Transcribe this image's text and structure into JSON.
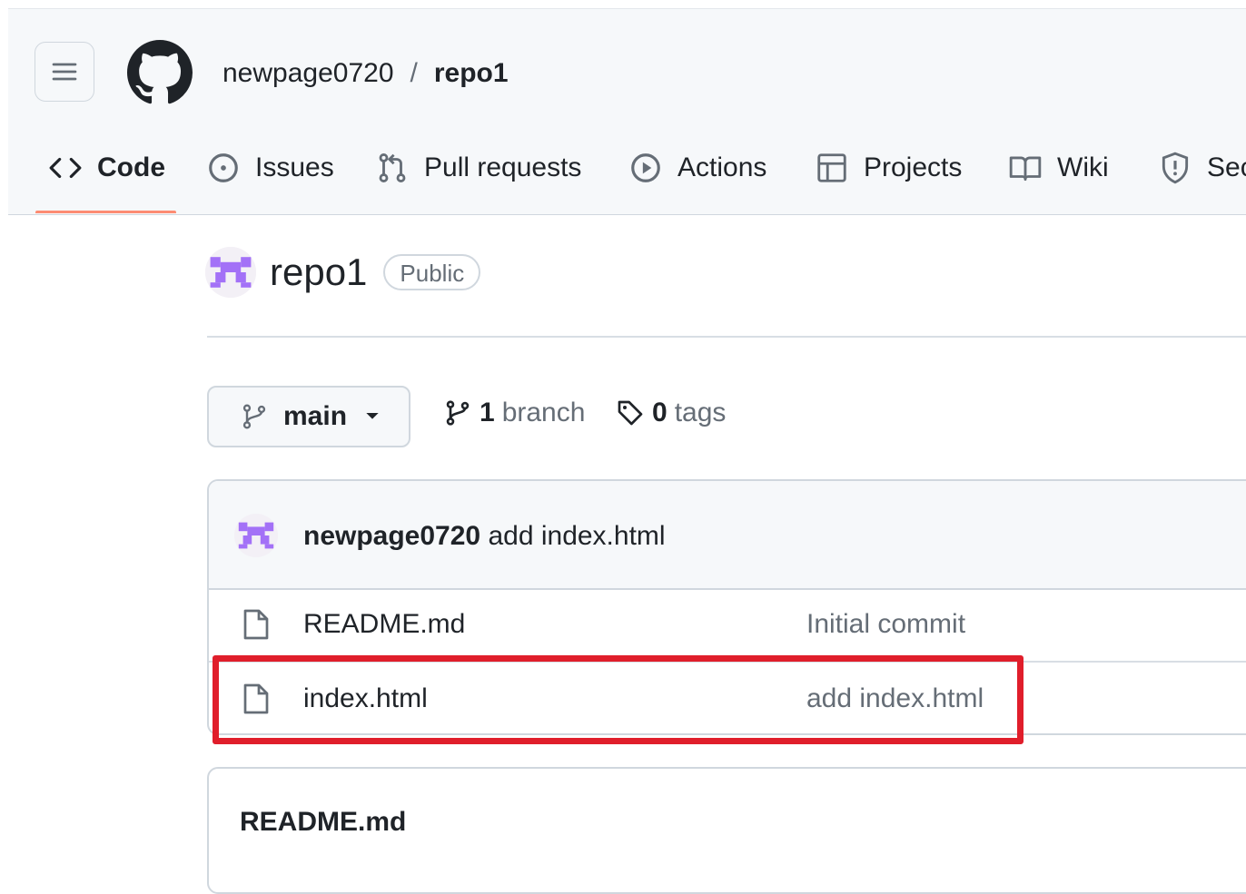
{
  "header": {
    "owner": "newpage0720",
    "separator": "/",
    "repo": "repo1"
  },
  "nav": {
    "tabs": [
      {
        "label": "Code",
        "icon": "code-icon",
        "active": true
      },
      {
        "label": "Issues",
        "icon": "issue-icon"
      },
      {
        "label": "Pull requests",
        "icon": "pull-request-icon"
      },
      {
        "label": "Actions",
        "icon": "play-icon"
      },
      {
        "label": "Projects",
        "icon": "table-icon"
      },
      {
        "label": "Wiki",
        "icon": "book-icon"
      },
      {
        "label": "Sec",
        "icon": "shield-icon"
      }
    ]
  },
  "repo": {
    "title": "repo1",
    "visibility": "Public"
  },
  "branch": {
    "current": "main",
    "branch_count": "1",
    "branch_label": "branch",
    "tag_count": "0",
    "tag_label": "tags"
  },
  "commit": {
    "author": "newpage0720",
    "message": "add index.html"
  },
  "files": [
    {
      "name": "README.md",
      "message": "Initial commit"
    },
    {
      "name": "index.html",
      "message": "add index.html"
    }
  ],
  "readme": {
    "title": "README.md"
  },
  "colors": {
    "accent_underline": "#fd8c73",
    "highlight": "#e01e2b",
    "avatar": "#a371f7"
  }
}
